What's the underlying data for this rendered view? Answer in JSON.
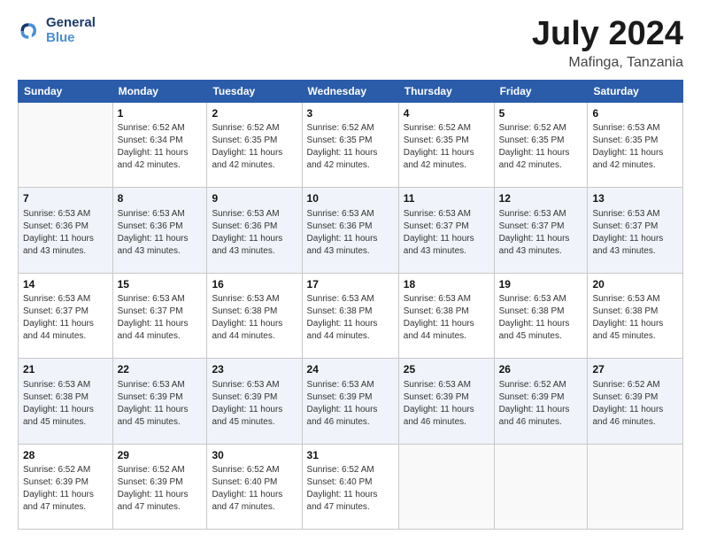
{
  "logo": {
    "line1": "General",
    "line2": "Blue"
  },
  "title": {
    "month_year": "July 2024",
    "location": "Mafinga, Tanzania"
  },
  "days_of_week": [
    "Sunday",
    "Monday",
    "Tuesday",
    "Wednesday",
    "Thursday",
    "Friday",
    "Saturday"
  ],
  "weeks": [
    [
      {
        "num": "",
        "sunrise": "",
        "sunset": "",
        "daylight": ""
      },
      {
        "num": "1",
        "sunrise": "Sunrise: 6:52 AM",
        "sunset": "Sunset: 6:34 PM",
        "daylight": "Daylight: 11 hours and 42 minutes."
      },
      {
        "num": "2",
        "sunrise": "Sunrise: 6:52 AM",
        "sunset": "Sunset: 6:35 PM",
        "daylight": "Daylight: 11 hours and 42 minutes."
      },
      {
        "num": "3",
        "sunrise": "Sunrise: 6:52 AM",
        "sunset": "Sunset: 6:35 PM",
        "daylight": "Daylight: 11 hours and 42 minutes."
      },
      {
        "num": "4",
        "sunrise": "Sunrise: 6:52 AM",
        "sunset": "Sunset: 6:35 PM",
        "daylight": "Daylight: 11 hours and 42 minutes."
      },
      {
        "num": "5",
        "sunrise": "Sunrise: 6:52 AM",
        "sunset": "Sunset: 6:35 PM",
        "daylight": "Daylight: 11 hours and 42 minutes."
      },
      {
        "num": "6",
        "sunrise": "Sunrise: 6:53 AM",
        "sunset": "Sunset: 6:35 PM",
        "daylight": "Daylight: 11 hours and 42 minutes."
      }
    ],
    [
      {
        "num": "7",
        "sunrise": "Sunrise: 6:53 AM",
        "sunset": "Sunset: 6:36 PM",
        "daylight": "Daylight: 11 hours and 43 minutes."
      },
      {
        "num": "8",
        "sunrise": "Sunrise: 6:53 AM",
        "sunset": "Sunset: 6:36 PM",
        "daylight": "Daylight: 11 hours and 43 minutes."
      },
      {
        "num": "9",
        "sunrise": "Sunrise: 6:53 AM",
        "sunset": "Sunset: 6:36 PM",
        "daylight": "Daylight: 11 hours and 43 minutes."
      },
      {
        "num": "10",
        "sunrise": "Sunrise: 6:53 AM",
        "sunset": "Sunset: 6:36 PM",
        "daylight": "Daylight: 11 hours and 43 minutes."
      },
      {
        "num": "11",
        "sunrise": "Sunrise: 6:53 AM",
        "sunset": "Sunset: 6:37 PM",
        "daylight": "Daylight: 11 hours and 43 minutes."
      },
      {
        "num": "12",
        "sunrise": "Sunrise: 6:53 AM",
        "sunset": "Sunset: 6:37 PM",
        "daylight": "Daylight: 11 hours and 43 minutes."
      },
      {
        "num": "13",
        "sunrise": "Sunrise: 6:53 AM",
        "sunset": "Sunset: 6:37 PM",
        "daylight": "Daylight: 11 hours and 43 minutes."
      }
    ],
    [
      {
        "num": "14",
        "sunrise": "Sunrise: 6:53 AM",
        "sunset": "Sunset: 6:37 PM",
        "daylight": "Daylight: 11 hours and 44 minutes."
      },
      {
        "num": "15",
        "sunrise": "Sunrise: 6:53 AM",
        "sunset": "Sunset: 6:37 PM",
        "daylight": "Daylight: 11 hours and 44 minutes."
      },
      {
        "num": "16",
        "sunrise": "Sunrise: 6:53 AM",
        "sunset": "Sunset: 6:38 PM",
        "daylight": "Daylight: 11 hours and 44 minutes."
      },
      {
        "num": "17",
        "sunrise": "Sunrise: 6:53 AM",
        "sunset": "Sunset: 6:38 PM",
        "daylight": "Daylight: 11 hours and 44 minutes."
      },
      {
        "num": "18",
        "sunrise": "Sunrise: 6:53 AM",
        "sunset": "Sunset: 6:38 PM",
        "daylight": "Daylight: 11 hours and 44 minutes."
      },
      {
        "num": "19",
        "sunrise": "Sunrise: 6:53 AM",
        "sunset": "Sunset: 6:38 PM",
        "daylight": "Daylight: 11 hours and 45 minutes."
      },
      {
        "num": "20",
        "sunrise": "Sunrise: 6:53 AM",
        "sunset": "Sunset: 6:38 PM",
        "daylight": "Daylight: 11 hours and 45 minutes."
      }
    ],
    [
      {
        "num": "21",
        "sunrise": "Sunrise: 6:53 AM",
        "sunset": "Sunset: 6:38 PM",
        "daylight": "Daylight: 11 hours and 45 minutes."
      },
      {
        "num": "22",
        "sunrise": "Sunrise: 6:53 AM",
        "sunset": "Sunset: 6:39 PM",
        "daylight": "Daylight: 11 hours and 45 minutes."
      },
      {
        "num": "23",
        "sunrise": "Sunrise: 6:53 AM",
        "sunset": "Sunset: 6:39 PM",
        "daylight": "Daylight: 11 hours and 45 minutes."
      },
      {
        "num": "24",
        "sunrise": "Sunrise: 6:53 AM",
        "sunset": "Sunset: 6:39 PM",
        "daylight": "Daylight: 11 hours and 46 minutes."
      },
      {
        "num": "25",
        "sunrise": "Sunrise: 6:53 AM",
        "sunset": "Sunset: 6:39 PM",
        "daylight": "Daylight: 11 hours and 46 minutes."
      },
      {
        "num": "26",
        "sunrise": "Sunrise: 6:52 AM",
        "sunset": "Sunset: 6:39 PM",
        "daylight": "Daylight: 11 hours and 46 minutes."
      },
      {
        "num": "27",
        "sunrise": "Sunrise: 6:52 AM",
        "sunset": "Sunset: 6:39 PM",
        "daylight": "Daylight: 11 hours and 46 minutes."
      }
    ],
    [
      {
        "num": "28",
        "sunrise": "Sunrise: 6:52 AM",
        "sunset": "Sunset: 6:39 PM",
        "daylight": "Daylight: 11 hours and 47 minutes."
      },
      {
        "num": "29",
        "sunrise": "Sunrise: 6:52 AM",
        "sunset": "Sunset: 6:39 PM",
        "daylight": "Daylight: 11 hours and 47 minutes."
      },
      {
        "num": "30",
        "sunrise": "Sunrise: 6:52 AM",
        "sunset": "Sunset: 6:40 PM",
        "daylight": "Daylight: 11 hours and 47 minutes."
      },
      {
        "num": "31",
        "sunrise": "Sunrise: 6:52 AM",
        "sunset": "Sunset: 6:40 PM",
        "daylight": "Daylight: 11 hours and 47 minutes."
      },
      {
        "num": "",
        "sunrise": "",
        "sunset": "",
        "daylight": ""
      },
      {
        "num": "",
        "sunrise": "",
        "sunset": "",
        "daylight": ""
      },
      {
        "num": "",
        "sunrise": "",
        "sunset": "",
        "daylight": ""
      }
    ]
  ]
}
